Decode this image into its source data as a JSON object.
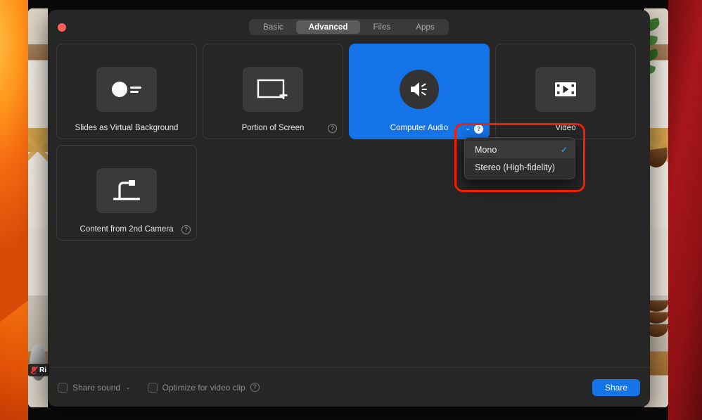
{
  "window": {
    "close_label": "Close",
    "tabs": [
      {
        "label": "Basic",
        "active": false
      },
      {
        "label": "Advanced",
        "active": true
      },
      {
        "label": "Files",
        "active": false
      },
      {
        "label": "Apps",
        "active": false
      }
    ]
  },
  "tiles": [
    {
      "label": "Slides as Virtual Background",
      "icon": "pie-chart-lines-icon",
      "selected": false,
      "help": false
    },
    {
      "label": "Portion of Screen",
      "icon": "rectangle-plus-icon",
      "selected": false,
      "help": true
    },
    {
      "label": "Computer Audio",
      "icon": "speaker-icon",
      "selected": true,
      "help": true
    },
    {
      "label": "Video",
      "icon": "film-play-icon",
      "selected": false,
      "help": false
    },
    {
      "label": "Content from 2nd Camera",
      "icon": "document-camera-icon",
      "selected": false,
      "help": true
    }
  ],
  "dropdown": {
    "items": [
      {
        "label": "Mono",
        "checked": true,
        "highlighted": true
      },
      {
        "label": "Stereo (High-fidelity)",
        "checked": false,
        "highlighted": false
      }
    ],
    "check_glyph": "✓"
  },
  "annotation": {
    "color": "#f02000"
  },
  "footer": {
    "share_sound": {
      "label": "Share sound",
      "checked": false,
      "chevron": "⌄"
    },
    "optimize": {
      "label": "Optimize for video clip",
      "checked": false
    },
    "help_glyph": "?",
    "share_button": "Share"
  },
  "participant": {
    "name": "Ri"
  },
  "colors": {
    "accent": "#1473e6",
    "highlight_blue": "#1e8fff",
    "close": "#ff5f57",
    "annotation": "#f02000"
  },
  "glyphs": {
    "help": "?",
    "chevron_down": "⌄"
  }
}
